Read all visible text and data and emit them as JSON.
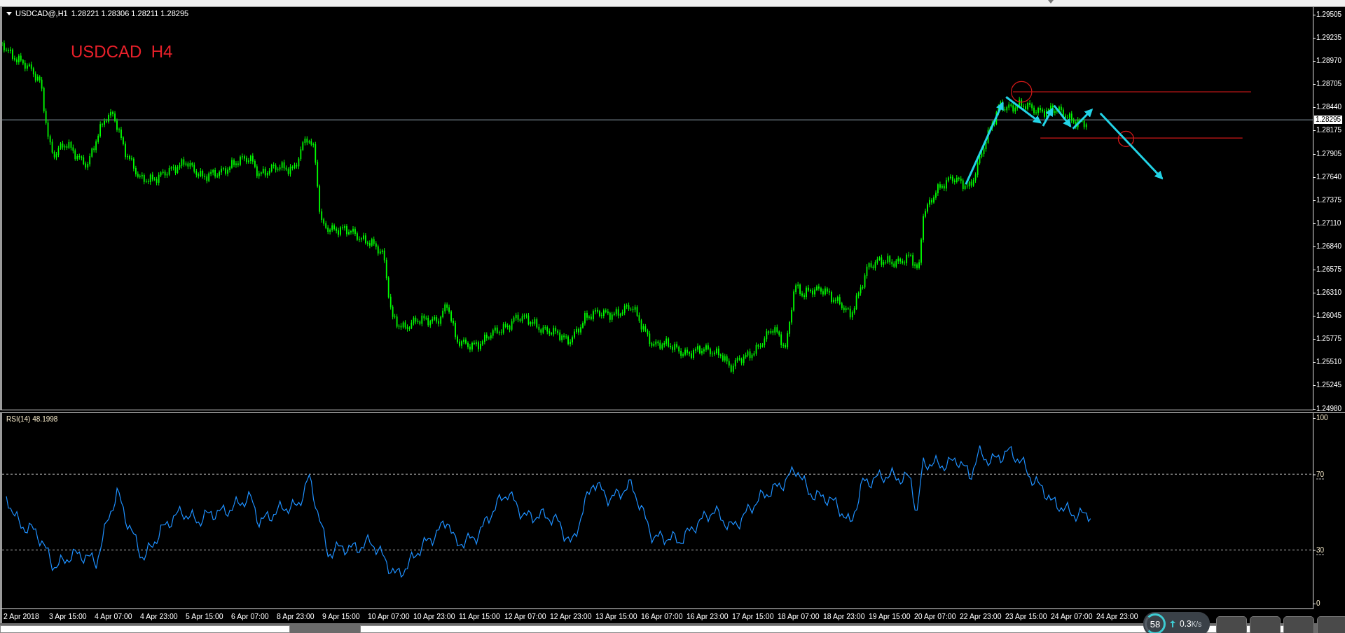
{
  "chart_header": {
    "symbol": "USDCAD@,H1",
    "ohlc": "1.28221 1.28306 1.28211 1.28295"
  },
  "annotation_label": "USDCAD  H4",
  "price_axis": {
    "ticks": [
      "1.29505",
      "1.29235",
      "1.28970",
      "1.28705",
      "1.28440",
      "1.28175",
      "1.27905",
      "1.27640",
      "1.27375",
      "1.27110",
      "1.26840",
      "1.26575",
      "1.26310",
      "1.26045",
      "1.25775",
      "1.25510",
      "1.25245",
      "1.24980"
    ],
    "current_price": "1.28295"
  },
  "rsi": {
    "label": "RSI(14) 48.1998",
    "ticks": [
      {
        "label": "100",
        "guide": false
      },
      {
        "label": "70",
        "guide": true
      },
      {
        "label": "30",
        "guide": true
      },
      {
        "label": "0",
        "guide": false
      }
    ]
  },
  "time_axis": [
    "2 Apr 2018",
    "3 Apr 15:00",
    "4 Apr 07:00",
    "4 Apr 23:00",
    "5 Apr 15:00",
    "6 Apr 07:00",
    "8 Apr 23:00",
    "9 Apr 15:00",
    "10 Apr 07:00",
    "10 Apr 23:00",
    "11 Apr 15:00",
    "12 Apr 07:00",
    "12 Apr 23:00",
    "13 Apr 15:00",
    "16 Apr 07:00",
    "16 Apr 23:00",
    "17 Apr 15:00",
    "18 Apr 07:00",
    "18 Apr 23:00",
    "19 Apr 15:00",
    "20 Apr 07:00",
    "22 Apr 23:00",
    "23 Apr 15:00",
    "24 Apr 07:00",
    "24 Apr 23:00"
  ],
  "network_widget": {
    "gauge": "58",
    "speed": "0.3",
    "unit": "K/s"
  }
}
